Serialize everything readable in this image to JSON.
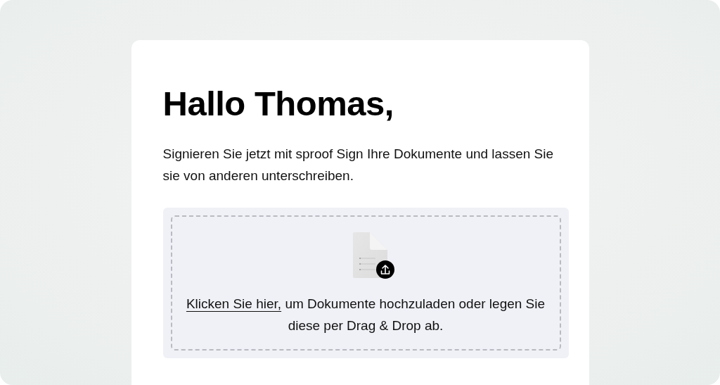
{
  "heading": "Hallo Thomas,",
  "intro": "Signieren Sie jetzt mit sproof Sign Ihre Dokumente und lassen Sie sie von anderen unterschreiben.",
  "upload": {
    "link": "Klicken Sie hier,",
    "text": "um Dokumente hochzuladen oder legen Sie diese per Drag & Drop ab."
  }
}
